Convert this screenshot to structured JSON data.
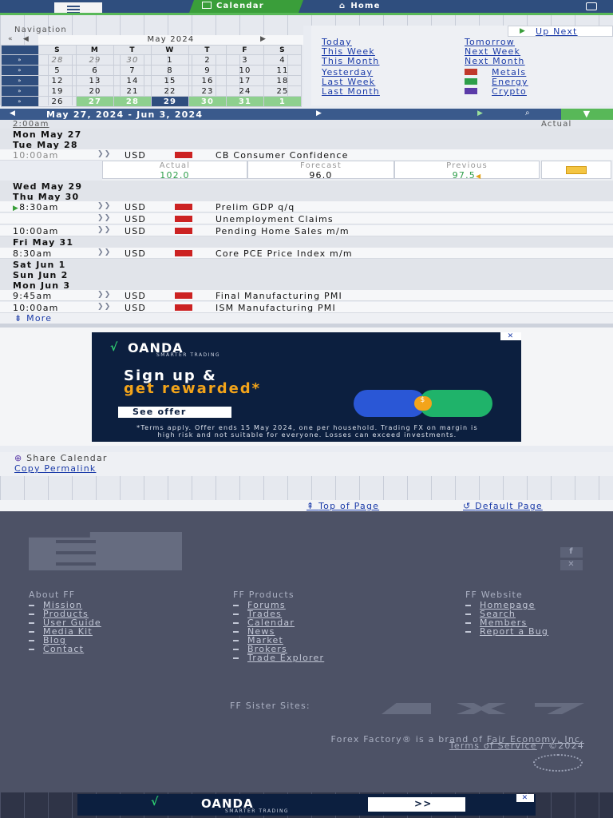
{
  "header": {
    "tab_calendar": "Calendar",
    "tab_home": "Home"
  },
  "nav": {
    "title": "Navigation",
    "month": "May 2024",
    "up_next": "Up Next",
    "weekdays": [
      "S",
      "M",
      "T",
      "W",
      "T",
      "F",
      "S"
    ],
    "weeks": [
      {
        "days": [
          {
            "d": "28",
            "s": "dim"
          },
          {
            "d": "29",
            "s": "dim"
          },
          {
            "d": "30",
            "s": "dim"
          },
          {
            "d": "1"
          },
          {
            "d": "2"
          },
          {
            "d": "3"
          },
          {
            "d": "4"
          }
        ]
      },
      {
        "days": [
          {
            "d": "5"
          },
          {
            "d": "6"
          },
          {
            "d": "7"
          },
          {
            "d": "8"
          },
          {
            "d": "9"
          },
          {
            "d": "10"
          },
          {
            "d": "11"
          }
        ]
      },
      {
        "days": [
          {
            "d": "12"
          },
          {
            "d": "13"
          },
          {
            "d": "14"
          },
          {
            "d": "15"
          },
          {
            "d": "16"
          },
          {
            "d": "17"
          },
          {
            "d": "18"
          }
        ]
      },
      {
        "days": [
          {
            "d": "19"
          },
          {
            "d": "20"
          },
          {
            "d": "21"
          },
          {
            "d": "22"
          },
          {
            "d": "23"
          },
          {
            "d": "24"
          },
          {
            "d": "25"
          }
        ]
      },
      {
        "days": [
          {
            "d": "26"
          },
          {
            "d": "27",
            "s": "cur"
          },
          {
            "d": "28",
            "s": "cur"
          },
          {
            "d": "29",
            "s": "today"
          },
          {
            "d": "30",
            "s": "cur"
          },
          {
            "d": "31",
            "s": "cur"
          },
          {
            "d": "1",
            "s": "cur"
          }
        ]
      }
    ],
    "links": {
      "today": "Today",
      "this_week": "This Week",
      "this_month": "This Month",
      "tomorrow": "Tomorrow",
      "next_week": "Next Week",
      "next_month": "Next Month",
      "yesterday": "Yesterday",
      "last_week": "Last Week",
      "last_month": "Last Month",
      "metals": "Metals",
      "energy": "Energy",
      "crypto": "Crypto"
    }
  },
  "range": {
    "label": "May 27, 2024 - Jun 3, 2024"
  },
  "table": {
    "first_time": "2:00am",
    "actual_header": "Actual",
    "days": {
      "mon_may_27": "Mon May 27",
      "tue_may_28": "Tue May 28",
      "wed_may_29": "Wed May 29",
      "thu_may_30": "Thu May 30",
      "fri_may_31": "Fri May 31",
      "sat_jun_1": "Sat Jun 1",
      "sun_jun_2": "Sun Jun 2",
      "mon_jun_3": "Mon Jun 3"
    },
    "events": [
      {
        "time": "10:00am",
        "currency": "USD",
        "event": "CB Consumer Confidence"
      },
      {
        "time": "8:30am",
        "currency": "USD",
        "event": "Prelim GDP q/q"
      },
      {
        "time": "",
        "currency": "USD",
        "event": "Unemployment Claims"
      },
      {
        "time": "10:00am",
        "currency": "USD",
        "event": "Pending Home Sales m/m"
      },
      {
        "time": "8:30am",
        "currency": "USD",
        "event": "Core PCE Price Index m/m"
      },
      {
        "time": "9:45am",
        "currency": "USD",
        "event": "Final Manufacturing PMI"
      },
      {
        "time": "10:00am",
        "currency": "USD",
        "event": "ISM Manufacturing PMI"
      }
    ],
    "detail": {
      "actual_label": "Actual",
      "actual_value": "102.0",
      "forecast_label": "Forecast",
      "forecast_value": "96.0",
      "previous_label": "Previous",
      "previous_value": "97.5"
    },
    "more": "More"
  },
  "ad": {
    "brand": "OANDA",
    "brand_sub": "SMARTER TRADING",
    "line1": "Sign up &",
    "line2": "get rewarded*",
    "cta": "See offer",
    "terms": "*Terms apply. Offer ends 15 May 2024, one per household. Trading FX on margin is high risk and not suitable for everyone. Losses can exceed investments.",
    "close": "✕"
  },
  "share": {
    "label": "Share Calendar",
    "permalink": "Copy Permalink"
  },
  "pagebar": {
    "top": "Top of Page",
    "default": "Default Page"
  },
  "footer": {
    "about_title": "About FF",
    "about": [
      "Mission",
      "Products",
      "User Guide",
      "Media Kit",
      "Blog",
      "Contact"
    ],
    "products_title": "FF Products",
    "products": [
      "Forums",
      "Trades",
      "Calendar",
      "News",
      "Market",
      "Brokers",
      "Trade Explorer"
    ],
    "website_title": "FF Website",
    "website": [
      "Homepage",
      "Search",
      "Members",
      "Report a Bug"
    ],
    "sister": "FF Sister Sites:",
    "brand_line_pre": "Forex Factory® is a brand of",
    "brand_owner": "Fair Economy, Inc.",
    "terms": "Terms of Service",
    "copyright": "/ ©2024"
  },
  "bottom_ad": {
    "brand": "OANDA",
    "brand_sub": "SMARTER TRADING",
    "cta": ">>"
  }
}
